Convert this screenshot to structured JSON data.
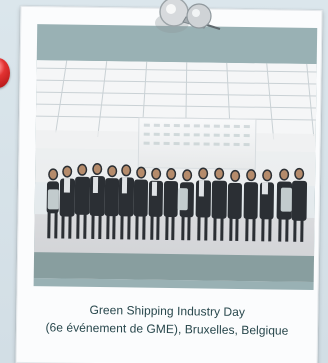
{
  "scene": {
    "background_color": "#d7e3ea",
    "frame_color": "#fbfcfd",
    "mat_color": "#99b1b4",
    "pin_color": "#e23232"
  },
  "photo": {
    "subject": "group-photo",
    "backdrop_color": "#f1f2f3",
    "floor_color": "#d7d8da"
  },
  "caption": {
    "line1": "Green Shipping Industry Day",
    "line2": "(6e événement de GME), Bruxelles, Belgique"
  },
  "icons": {
    "thumbtack": "thumbtack-icon",
    "pushpin": "red-pushpin-icon"
  }
}
